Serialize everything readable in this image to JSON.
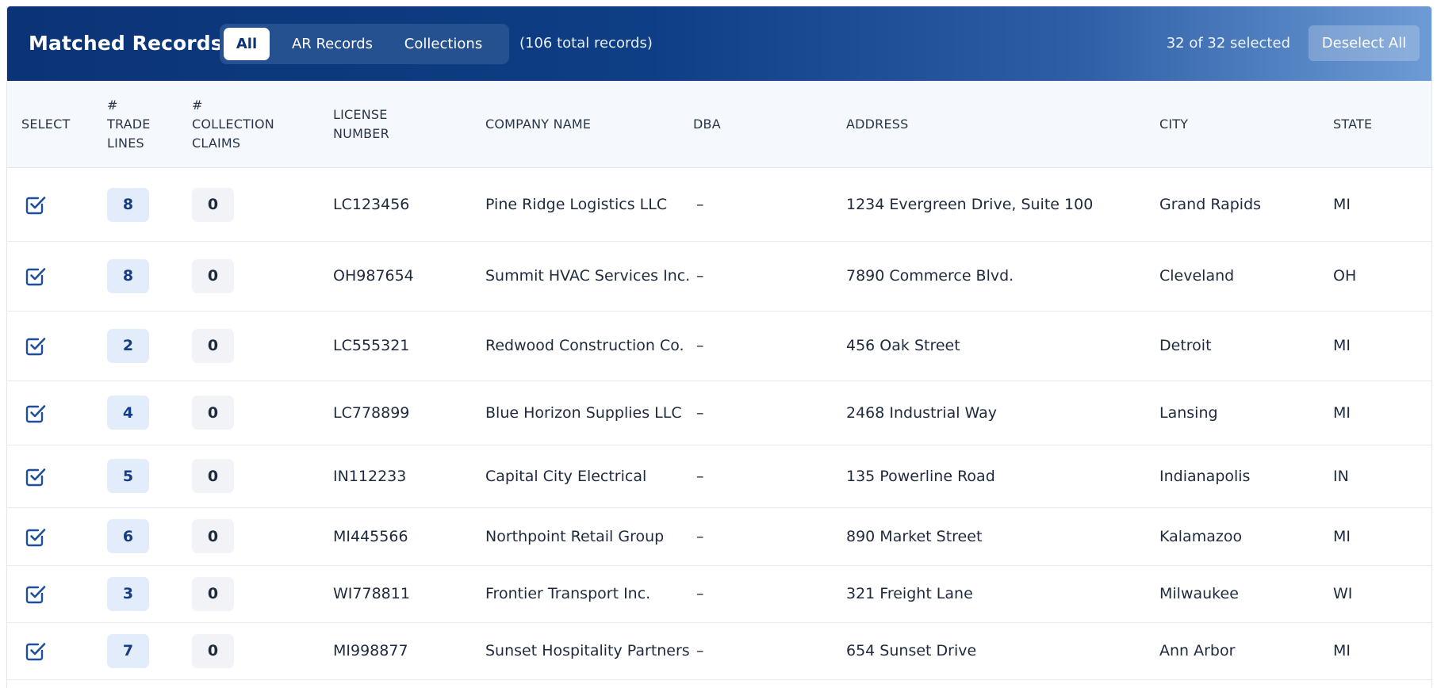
{
  "header": {
    "title": "Matched Records",
    "tabs": [
      {
        "label": "All",
        "active": true
      },
      {
        "label": "AR Records",
        "active": false
      },
      {
        "label": "Collections",
        "active": false
      }
    ],
    "total_records": "(106 total records)",
    "selected_count": "32 of 32 selected",
    "deselect_label": "Deselect All"
  },
  "colors": {
    "header_dark": "#0b3476",
    "header_light": "#6d9bd5",
    "check_blue": "#1f4f9c",
    "trade_badge_bg": "#e2ecfb",
    "claim_badge_bg": "#f1f3f6"
  },
  "table": {
    "columns": {
      "select": "SELECT",
      "trade_lines": [
        "#",
        "TRADE",
        "LINES"
      ],
      "collection_claims": [
        "#",
        "COLLECTION",
        "CLAIMS"
      ],
      "license_number": [
        "LICENSE",
        "NUMBER"
      ],
      "company_name": "COMPANY NAME",
      "dba": "DBA",
      "address": "ADDRESS",
      "city": "CITY",
      "state": "STATE"
    },
    "rows": [
      {
        "checked": true,
        "trade_lines": "8",
        "collection_claims": "0",
        "license": "LC123456",
        "company": "Pine Ridge Logistics LLC",
        "dba": "–",
        "address": "1234 Evergreen Drive, Suite 100",
        "city": "Grand Rapids",
        "state": "MI"
      },
      {
        "checked": true,
        "trade_lines": "8",
        "collection_claims": "0",
        "license": "OH987654",
        "company": "Summit HVAC Services Inc.",
        "dba": "–",
        "address": "7890 Commerce Blvd.",
        "city": "Cleveland",
        "state": "OH"
      },
      {
        "checked": true,
        "trade_lines": "2",
        "collection_claims": "0",
        "license": "LC555321",
        "company": "Redwood Construction Co.",
        "dba": "–",
        "address": "456 Oak Street",
        "city": "Detroit",
        "state": "MI"
      },
      {
        "checked": true,
        "trade_lines": "4",
        "collection_claims": "0",
        "license": "LC778899",
        "company": "Blue Horizon Supplies LLC",
        "dba": "–",
        "address": "2468 Industrial Way",
        "city": "Lansing",
        "state": "MI"
      },
      {
        "checked": true,
        "trade_lines": "5",
        "collection_claims": "0",
        "license": "IN112233",
        "company": "Capital City Electrical",
        "dba": "–",
        "address": "135 Powerline Road",
        "city": "Indianapolis",
        "state": "IN"
      },
      {
        "checked": true,
        "trade_lines": "6",
        "collection_claims": "0",
        "license": "MI445566",
        "company": "Northpoint Retail Group",
        "dba": "–",
        "address": "890 Market Street",
        "city": "Kalamazoo",
        "state": "MI"
      },
      {
        "checked": true,
        "trade_lines": "3",
        "collection_claims": "0",
        "license": "WI778811",
        "company": "Frontier Transport Inc.",
        "dba": "–",
        "address": "321 Freight Lane",
        "city": "Milwaukee",
        "state": "WI"
      },
      {
        "checked": true,
        "trade_lines": "7",
        "collection_claims": "0",
        "license": "MI998877",
        "company": "Sunset Hospitality Partners",
        "dba": "–",
        "address": "654 Sunset Drive",
        "city": "Ann Arbor",
        "state": "MI"
      }
    ]
  }
}
